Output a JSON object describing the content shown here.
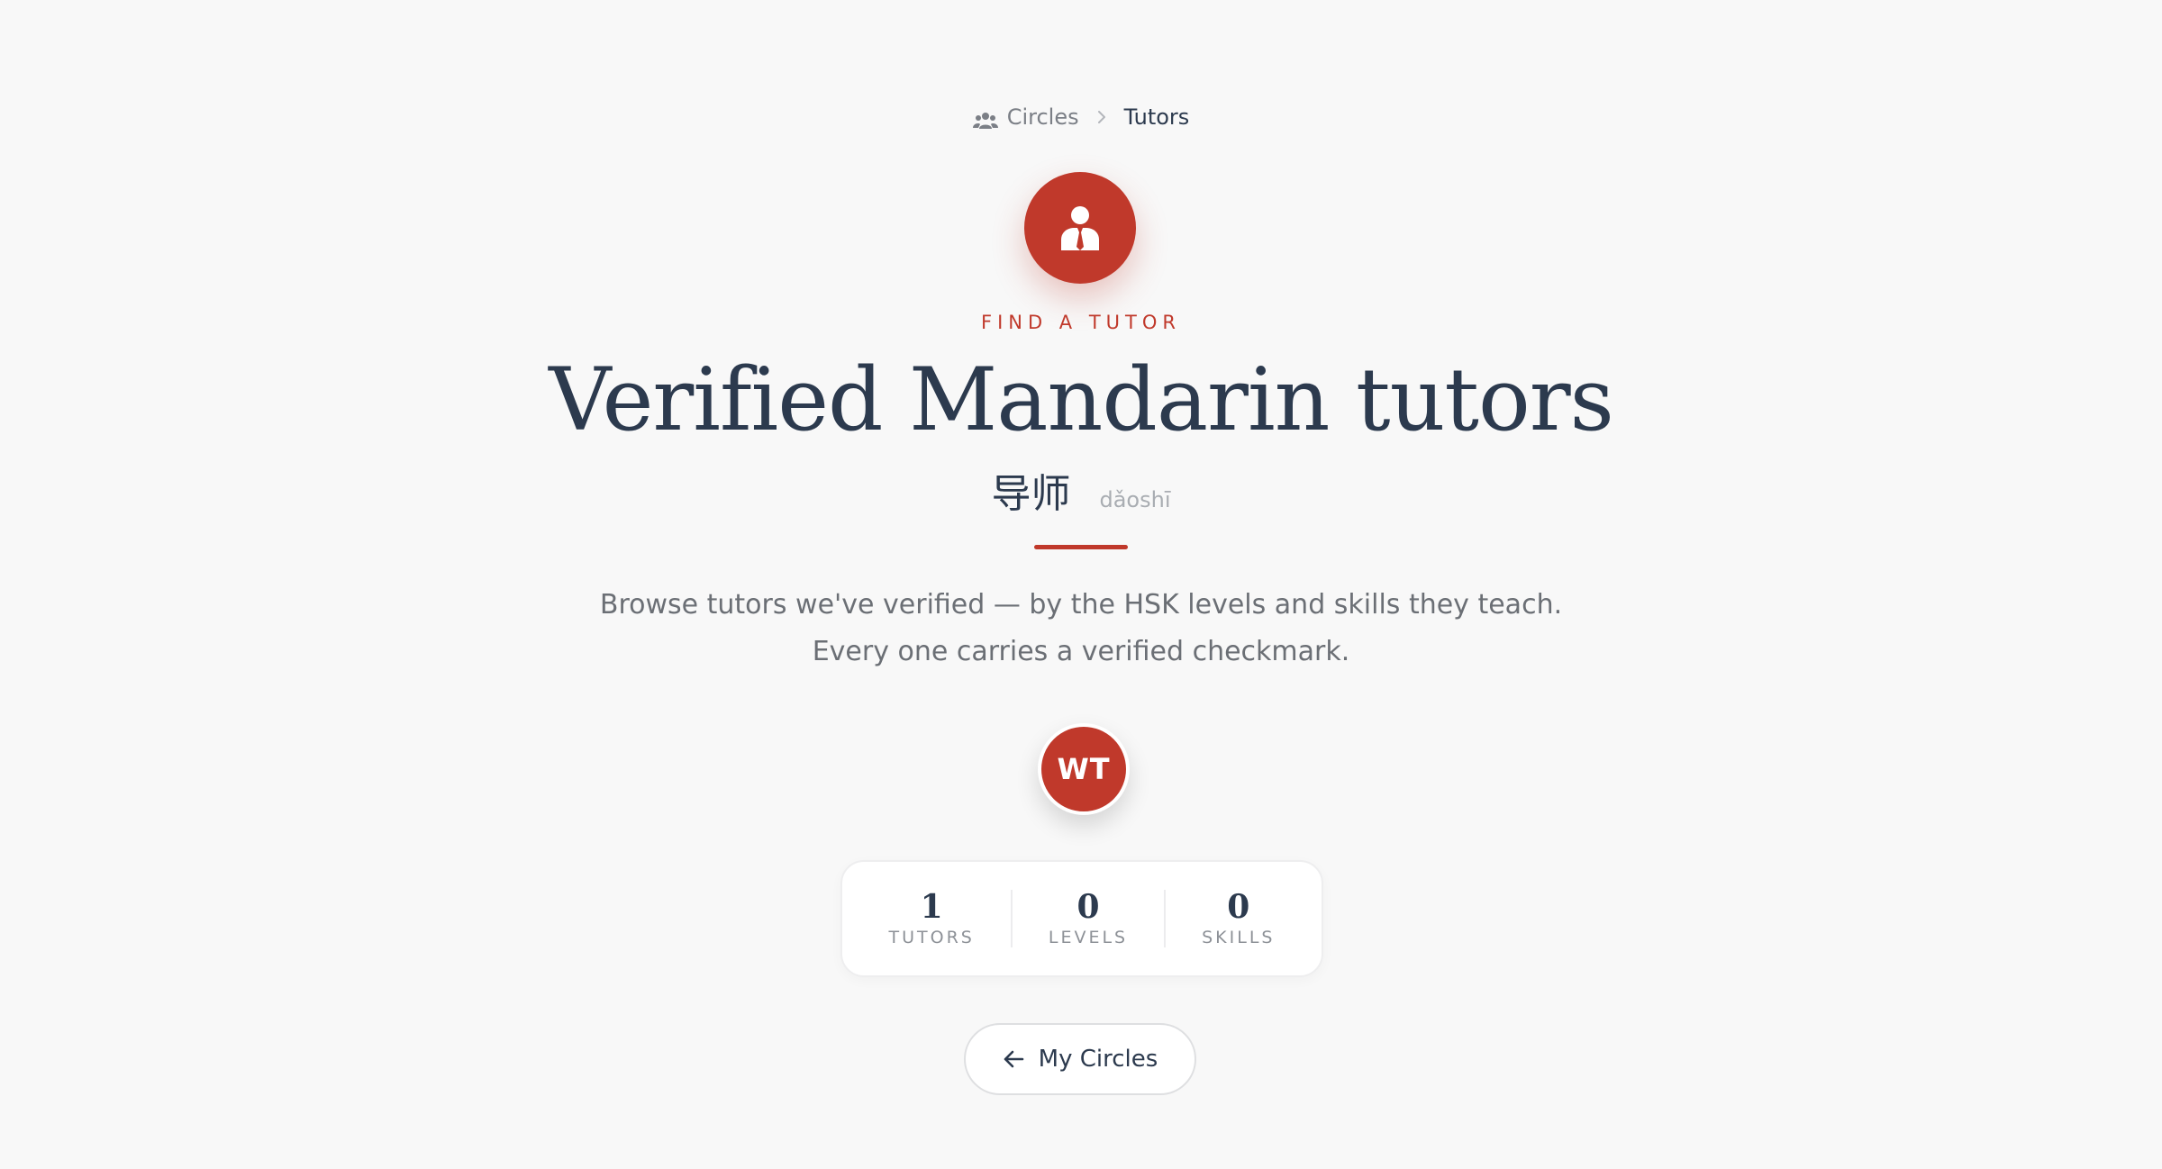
{
  "breadcrumb": {
    "items": [
      {
        "label": "Circles",
        "icon": "people-icon"
      },
      {
        "label": "Tutors"
      }
    ]
  },
  "hero": {
    "icon": "tutor-icon",
    "eyebrow": "FIND A TUTOR",
    "title": "Verified Mandarin tutors",
    "hanzi": "导师",
    "pinyin": "dǎoshī",
    "description": "Browse tutors we've verified — by the HSK levels and skills they teach. Every one carries a verified checkmark."
  },
  "avatars": [
    {
      "initials": "WT"
    }
  ],
  "stats": [
    {
      "value": "1",
      "label": "TUTORS"
    },
    {
      "value": "0",
      "label": "LEVELS"
    },
    {
      "value": "0",
      "label": "SKILLS"
    }
  ],
  "actions": {
    "back_label": "My Circles",
    "back_icon": "arrow-left-icon"
  },
  "colors": {
    "accent": "#c0392b",
    "text": "#2c3a4e",
    "muted": "#6b6f75",
    "background": "#f8f8f8"
  }
}
